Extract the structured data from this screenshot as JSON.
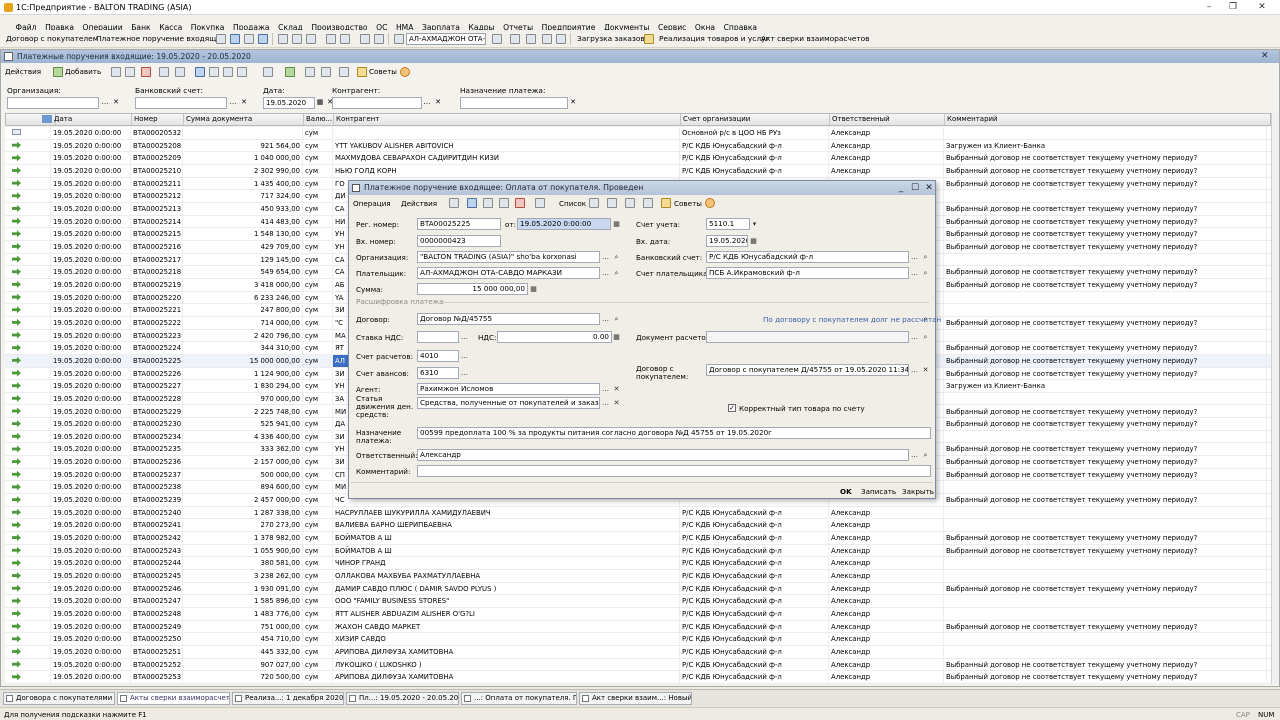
{
  "window": {
    "title": "1С:Предприятие - BALTON TRADING (ASIA)"
  },
  "menu": [
    "Файл",
    "Правка",
    "Операции",
    "Банк",
    "Касса",
    "Покупка",
    "Продажа",
    "Склад",
    "Производство",
    "ОС",
    "НМА",
    "Зарплата",
    "Кадры",
    "Отчеты",
    "Предприятие",
    "Документы",
    "Сервис",
    "Окна",
    "Справка"
  ],
  "toolbar1": {
    "link1": "Договор с покупателем",
    "link2": "Платежное поручение входящее",
    "combo": "АЛ-АХМАДЖОН ОТА-С",
    "btn_orders": "Загрузка заказов",
    "btn_sales": "Реализация товаров и услуг",
    "btn_recon": "Акт сверки взаиморасчетов"
  },
  "list": {
    "title": "Платежные поручения входящие: 19.05.2020 - 20.05.2020",
    "actions": "Действия",
    "add": "Добавить",
    "advice": "Советы",
    "filters": {
      "org": "Организация:",
      "bank": "Банковский счет:",
      "date": "Дата:",
      "date_value": "19.05.2020",
      "contr": "Контрагент:",
      "purpose": "Назначение платежа:"
    },
    "columns": [
      "Дата",
      "Номер",
      "Сумма документа",
      "Валю...",
      "Контрагент",
      "Счет организации",
      "Ответственный",
      "Комментарий"
    ],
    "rows": [
      [
        "19.05.2020 0:00:00",
        "BTA00020532",
        "",
        "сум",
        "",
        "Основной р/с в ЦОО НБ РУз",
        "Александр",
        ""
      ],
      [
        "19.05.2020 0:00:00",
        "BTA00025208",
        "921 564,00",
        "сум",
        "YTT YAKUBOV ALISHER ABITOVICH",
        "Р/С КДБ Юнусабадский ф-л",
        "Александр",
        "Загружен из Клиент-Банка"
      ],
      [
        "19.05.2020 0:00:00",
        "BTA00025209",
        "1 040 000,00",
        "сум",
        "МАХМУДОВА СЕВАРАХОН САДИРИТДИН КИЗИ",
        "Р/С КДБ Юнусабадский ф-л",
        "Александр",
        "Выбранный договор не соответствует текущему учетному периоду?"
      ],
      [
        "19.05.2020 0:00:00",
        "BTA00025210",
        "2 302 990,00",
        "сум",
        "НЬЮ ГОЛД КОРН",
        "Р/С КДБ Юнусабадский ф-л",
        "Александр",
        "Выбранный договор не соответствует текущему учетному периоду?"
      ],
      [
        "19.05.2020 0:00:00",
        "BTA00025211",
        "1 435 400,00",
        "сум",
        "ГО",
        "",
        "",
        "Выбранный договор не соответствует текущему учетному периоду?"
      ],
      [
        "19.05.2020 0:00:00",
        "BTA00025212",
        "717 324,00",
        "сум",
        "ДИ",
        "",
        "",
        ""
      ],
      [
        "19.05.2020 0:00:00",
        "BTA00025213",
        "450 933,00",
        "сум",
        "СА",
        "",
        "",
        "Выбранный договор не соответствует текущему учетному периоду?"
      ],
      [
        "19.05.2020 0:00:00",
        "BTA00025214",
        "414 483,00",
        "сум",
        "НИ",
        "",
        "",
        "Выбранный договор не соответствует текущему учетному периоду?"
      ],
      [
        "19.05.2020 0:00:00",
        "BTA00025215",
        "1 548 130,00",
        "сум",
        "УН",
        "",
        "",
        "Выбранный договор не соответствует текущему учетному периоду?"
      ],
      [
        "19.05.2020 0:00:00",
        "BTA00025216",
        "429 709,00",
        "сум",
        "УН",
        "",
        "",
        "Выбранный договор не соответствует текущему учетному периоду?"
      ],
      [
        "19.05.2020 0:00:00",
        "BTA00025217",
        "129 145,00",
        "сум",
        "СА",
        "",
        "",
        ""
      ],
      [
        "19.05.2020 0:00:00",
        "BTA00025218",
        "549 654,00",
        "сум",
        "СА",
        "",
        "",
        "Выбранный договор не соответствует текущему учетному периоду?"
      ],
      [
        "19.05.2020 0:00:00",
        "BTA00025219",
        "3 418 000,00",
        "сум",
        "АБ",
        "",
        "",
        "Выбранный договор не соответствует текущему учетному периоду?"
      ],
      [
        "19.05.2020 0:00:00",
        "BTA00025220",
        "6 233 246,00",
        "сум",
        "YA",
        "",
        "",
        ""
      ],
      [
        "19.05.2020 0:00:00",
        "BTA00025221",
        "247 800,00",
        "сум",
        "ЗИ",
        "",
        "",
        ""
      ],
      [
        "19.05.2020 0:00:00",
        "BTA00025222",
        "714 000,00",
        "сум",
        "\"С",
        "",
        "",
        "Выбранный договор не соответствует текущему учетному периоду?"
      ],
      [
        "19.05.2020 0:00:00",
        "BTA00025223",
        "2 420 796,00",
        "сум",
        "МА",
        "",
        "",
        ""
      ],
      [
        "19.05.2020 0:00:00",
        "BTA00025224",
        "344 310,00",
        "сум",
        "ЯТ",
        "",
        "",
        "Выбранный договор не соответствует текущему учетному периоду?"
      ],
      [
        "19.05.2020 0:00:00",
        "BTA00025225",
        "15 000 000,00",
        "сум",
        "АЛ",
        "",
        "",
        "Выбранный договор не соответствует текущему учетному периоду?"
      ],
      [
        "19.05.2020 0:00:00",
        "BTA00025226",
        "1 124 900,00",
        "сум",
        "ЗИ",
        "",
        "",
        "Выбранный договор не соответствует текущему учетному периоду?"
      ],
      [
        "19.05.2020 0:00:00",
        "BTA00025227",
        "1 830 294,00",
        "сум",
        "УН",
        "",
        "",
        "Загружен из Клиент-Банка"
      ],
      [
        "19.05.2020 0:00:00",
        "BTA00025228",
        "970 000,00",
        "сум",
        "ЗА",
        "",
        "",
        ""
      ],
      [
        "19.05.2020 0:00:00",
        "BTA00025229",
        "2 225 748,00",
        "сум",
        "МИ",
        "",
        "",
        "Выбранный договор не соответствует текущему учетному периоду?"
      ],
      [
        "19.05.2020 0:00:00",
        "BTA00025230",
        "525 941,00",
        "сум",
        "ДА",
        "",
        "",
        "Выбранный договор не соответствует текущему учетному периоду?"
      ],
      [
        "19.05.2020 0:00:00",
        "BTA00025234",
        "4 336 400,00",
        "сум",
        "ЗИ",
        "",
        "",
        ""
      ],
      [
        "19.05.2020 0:00:00",
        "BTA00025235",
        "333 362,00",
        "сум",
        "УН",
        "",
        "",
        "Выбранный договор не соответствует текущему учетному периоду?"
      ],
      [
        "19.05.2020 0:00:00",
        "BTA00025236",
        "2 157 000,00",
        "сум",
        "ЗИ",
        "",
        "",
        "Выбранный договор не соответствует текущему учетному периоду?"
      ],
      [
        "19.05.2020 0:00:00",
        "BTA00025237",
        "500 000,00",
        "сум",
        "СП",
        "",
        "",
        "Выбранный договор не соответствует текущему учетному периоду?"
      ],
      [
        "19.05.2020 0:00:00",
        "BTA00025238",
        "894 600,00",
        "сум",
        "МИ",
        "",
        "",
        ""
      ],
      [
        "19.05.2020 0:00:00",
        "BTA00025239",
        "2 457 000,00",
        "сум",
        "ЧС",
        "",
        "",
        "Выбранный договор не соответствует текущему учетному периоду?"
      ],
      [
        "19.05.2020 0:00:00",
        "BTA00025240",
        "1 287 338,00",
        "сум",
        "НАСРУЛЛАЕВ ШУКУРИЛЛА ХАМИДУЛАЕВИЧ",
        "Р/С КДБ Юнусабадский ф-л",
        "Александр",
        ""
      ],
      [
        "19.05.2020 0:00:00",
        "BTA00025241",
        "270 273,00",
        "сум",
        "ВАЛИЕВА БАРНО ШЕРИПБАЕВНА",
        "Р/С КДБ Юнусабадский ф-л",
        "Александр",
        ""
      ],
      [
        "19.05.2020 0:00:00",
        "BTA00025242",
        "1 378 982,00",
        "сум",
        "БОЙМАТОВ А Ш",
        "Р/С КДБ Юнусабадский ф-л",
        "Александр",
        "Выбранный договор не соответствует текущему учетному периоду?"
      ],
      [
        "19.05.2020 0:00:00",
        "BTA00025243",
        "1 055 900,00",
        "сум",
        "БОЙМАТОВ А Ш",
        "Р/С КДБ Юнусабадский ф-л",
        "Александр",
        "Выбранный договор не соответствует текущему учетному периоду?"
      ],
      [
        "19.05.2020 0:00:00",
        "BTA00025244",
        "380 581,00",
        "сум",
        "ЧИНОР ГРАНД",
        "Р/С КДБ Юнусабадский ф-л",
        "Александр",
        ""
      ],
      [
        "19.05.2020 0:00:00",
        "BTA00025245",
        "3 238 262,00",
        "сум",
        "ОЛЛАКОВА МАХБУБА РАХМАТУЛЛАЕВНА",
        "Р/С КДБ Юнусабадский ф-л",
        "Александр",
        ""
      ],
      [
        "19.05.2020 0:00:00",
        "BTA00025246",
        "1 930 091,00",
        "сум",
        "ДАМИР САВДО ПЛЮС ( DAMIR SAVDO PLYUS )",
        "Р/С КДБ Юнусабадский ф-л",
        "Александр",
        "Выбранный договор не соответствует текущему учетному периоду?"
      ],
      [
        "19.05.2020 0:00:00",
        "BTA00025247",
        "1 585 896,00",
        "сум",
        "ООО \"FAMILY BUSINESS STORES\"",
        "Р/С КДБ Юнусабадский ф-л",
        "Александр",
        ""
      ],
      [
        "19.05.2020 0:00:00",
        "BTA00025248",
        "1 483 776,00",
        "сум",
        "ЯТТ ALISHER ABDUAZIM ALISHER O'G?LI",
        "Р/С КДБ Юнусабадский ф-л",
        "Александр",
        ""
      ],
      [
        "19.05.2020 0:00:00",
        "BTA00025249",
        "751 000,00",
        "сум",
        "ЖАХОН САВДО МАРКЕТ",
        "Р/С КДБ Юнусабадский ф-л",
        "Александр",
        "Выбранный договор не соответствует текущему учетному периоду?"
      ],
      [
        "19.05.2020 0:00:00",
        "BTA00025250",
        "454 710,00",
        "сум",
        "ХИЗИР САВДО",
        "Р/С КДБ Юнусабадский ф-л",
        "Александр",
        ""
      ],
      [
        "19.05.2020 0:00:00",
        "BTA00025251",
        "445 332,00",
        "сум",
        "АРИПОВА ДИЛФУЗА ХАМИТОВНА",
        "Р/С КДБ Юнусабадский ф-л",
        "Александр",
        ""
      ],
      [
        "19.05.2020 0:00:00",
        "BTA00025252",
        "907 027,00",
        "сум",
        "ЛУКОШКО ( LUKOSHKO )",
        "Р/С КДБ Юнусабадский ф-л",
        "Александр",
        "Выбранный договор не соответствует текущему учетному периоду?"
      ],
      [
        "19.05.2020 0:00:00",
        "BTA00025253",
        "720 500,00",
        "сум",
        "АРИПОВА ДИЛФУЗА ХАМИТОВНА",
        "Р/С КДБ Юнусабадский ф-л",
        "Александр",
        "Выбранный договор не соответствует текущему учетному периоду?"
      ]
    ]
  },
  "dialog": {
    "title": "Платежное поручение входящее: Оплата от покупателя. Проведен",
    "tb": {
      "operation": "Операция",
      "actions": "Действия",
      "list": "Список",
      "advice": "Советы"
    },
    "reg_label": "Рег. номер:",
    "reg_value": "BTA00025225",
    "from_label": "от:",
    "from_value": "19.05.2020 0:00:00",
    "in_label": "Вх. номер:",
    "in_value": "0000000423",
    "org_label": "Организация:",
    "org_value": "\"BALTON TRADING (ASIA)\" sho'ba korxonasi",
    "payer_label": "Плательщик:",
    "payer_value": "АЛ-АХМАДЖОН ОТА-САВДО МАРКАЗИ",
    "sum_label": "Сумма:",
    "sum_value": "15 000 000,00",
    "acc_label": "Счет учета:",
    "acc_value": "5110.1",
    "indate_label": "Вх. дата:",
    "indate_value": "19.05.2020",
    "bank_label": "Банковский счет:",
    "bank_value": "Р/С КДБ Юнусабадский ф-л",
    "payeracc_label": "Счет плательщика:",
    "payeracc_value": "ПСБ А.Икрамовский ф-л",
    "section": "Расшифровка платежа",
    "contract_label": "Договор:",
    "contract_value": "Договор №Д/45755",
    "debt_link": "По договору с покупателем долг не рассчитан",
    "vat_label": "Ставка НДС:",
    "vat2_label": "НДС:",
    "vat2_value": "0.00",
    "docsettle_label": "Документ расчетов:",
    "settle_label": "Счет расчетов:",
    "settle_value": "4010",
    "adv_label": "Счет авансов:",
    "adv_value": "6310",
    "buyer_contract_label": "Договор с покупателем:",
    "buyer_contract_value": "Договор с покупателем Д/45755 от 19.05.2020 11:34:49",
    "agent_label": "Агент:",
    "agent_value": "Рахимжон Исломов",
    "flow_label": "Статья движения ден. средств:",
    "flow_value": "Средства, полученные от покупателей и заказчиков",
    "check_label": "Корректный тип товара по счету",
    "purpose_label": "Назначение платежа:",
    "purpose_value": "00599 предоплата 100 % за продукты питания согласно договора №Д 45755 от 19.05.2020г",
    "resp_label": "Ответственный:",
    "resp_value": "Александр",
    "comment_label": "Комментарий:",
    "ok": "OK",
    "save": "Записать",
    "close": "Закрыть"
  },
  "tasks": [
    "Договора с покупателями",
    "Акты сверки взаиморасчет...",
    "Реализа...: 1 декабря 2020 г....",
    "Пл...: 19.05.2020 - 20.05.2020",
    "...: Оплата от покупателя. П...",
    "Акт сверки взаим...: Новый *"
  ],
  "status": {
    "hint": "Для получения подсказки нажмите F1",
    "cap": "CAP",
    "num": "NUM"
  }
}
